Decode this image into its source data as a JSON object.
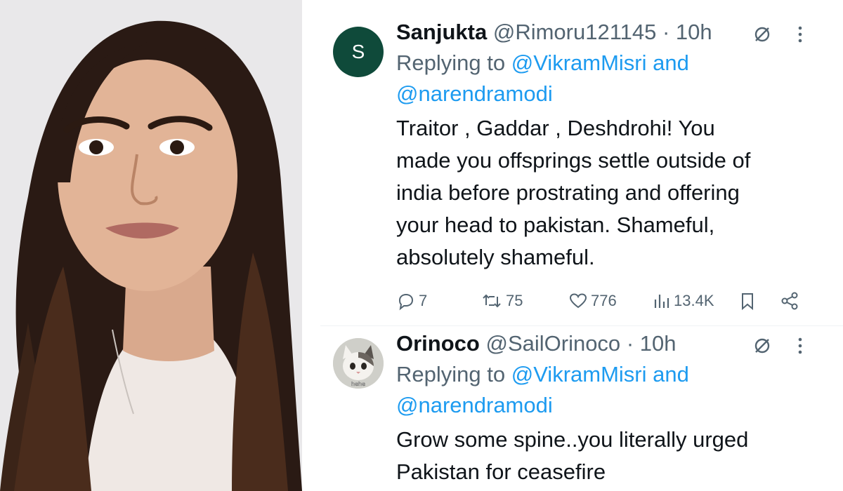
{
  "tweets": [
    {
      "avatar_letter": "S",
      "avatar_color": "#0f4a3a",
      "display_name": "Sanjukta",
      "handle": "@Rimoru121145",
      "time": "· 10h",
      "replying_prefix": "Replying to",
      "mention1": "@VikramMisri and",
      "mention2": "@narendramodi",
      "text_lines": [
        "Traitor , Gaddar , Deshdrohi! You",
        "made you offsprings settle outside of",
        "india before prostrating and offering",
        "your head to pakistan. Shameful,",
        "absolutely shameful."
      ],
      "stats": {
        "replies": "7",
        "reposts": "75",
        "likes": "776",
        "views": "13.4K"
      }
    },
    {
      "avatar_caption": "hehe",
      "display_name": "Orinoco",
      "handle": "@SailOrinoco",
      "time": "· 10h",
      "replying_prefix": "Replying to",
      "mention1": "@VikramMisri and",
      "mention2": "@narendramodi",
      "text_lines": [
        "Grow some spine..you literally urged",
        "Pakistan for ceasefire"
      ]
    }
  ],
  "icons": {
    "grok": "grok-icon",
    "more": "more-vertical-icon",
    "reply": "comment-icon",
    "repost": "repost-icon",
    "like": "heart-icon",
    "views": "views-icon",
    "bookmark": "bookmark-icon",
    "share": "share-icon"
  },
  "colors": {
    "link": "#1d9bf0",
    "secondary_text": "#536471",
    "primary_text": "#0f1419"
  }
}
